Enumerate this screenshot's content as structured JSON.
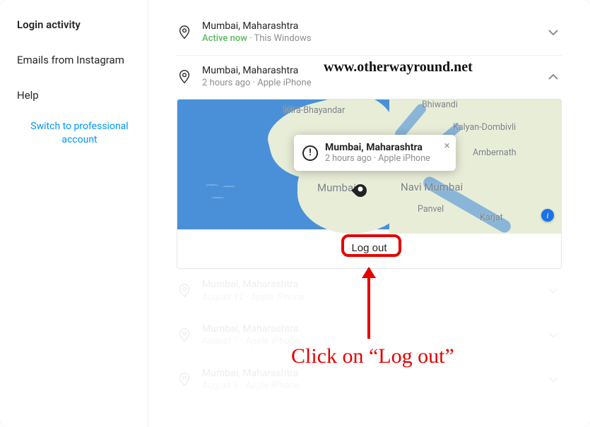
{
  "sidebar": {
    "items": [
      {
        "label": "Login activity"
      },
      {
        "label": "Emails from Instagram"
      },
      {
        "label": "Help"
      }
    ],
    "switch_link": "Switch to professional account"
  },
  "sessions": {
    "current": {
      "location": "Mumbai, Maharashtra",
      "status": "Active now",
      "sep": " · ",
      "device": "This Windows"
    },
    "expanded": {
      "location": "Mumbai, Maharashtra",
      "time": "2 hours ago",
      "sep": " · ",
      "device": "Apple iPhone"
    },
    "faded": [
      {
        "location": "Mumbai, Maharashtra",
        "meta": "August 12 · Apple iPhone"
      },
      {
        "location": "Mumbai, Maharashtra",
        "meta": "August 7 · Apple iPhone"
      },
      {
        "location": "Mumbai, Maharashtra",
        "meta": "August 6 · Apple iPhone"
      }
    ]
  },
  "map": {
    "labels": {
      "mira": "Mira-Bhayandar",
      "bhiwandi": "Bhiwandi",
      "kalyan": "Kalyan-Dombivli",
      "ambernath": "Ambernath",
      "navi": "Navi Mumbai",
      "panvel": "Panvel",
      "karjat": "Karjat",
      "mumbai": "Mumbai"
    },
    "popup": {
      "title": "Mumbai, Maharashtra",
      "sub": "2 hours ago · Apple iPhone",
      "close": "×"
    }
  },
  "actions": {
    "logout": "Log out"
  },
  "annotations": {
    "url": "www.otherwayround.net",
    "callout": "Click on “Log out”"
  }
}
